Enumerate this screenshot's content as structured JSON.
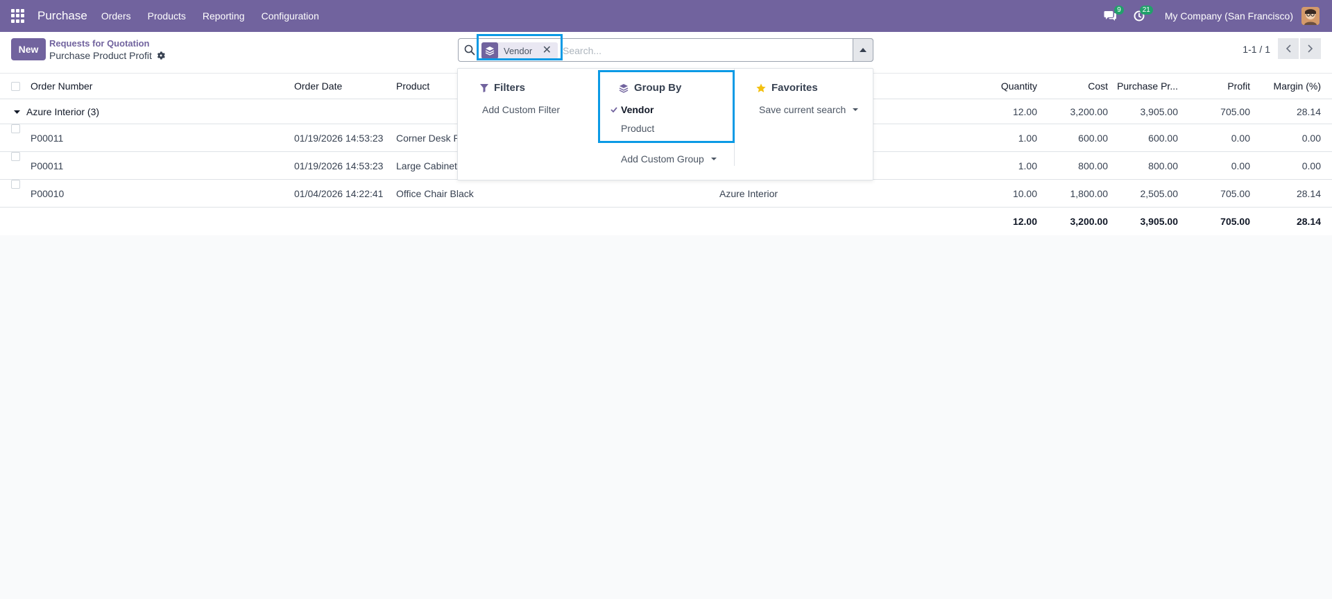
{
  "navbar": {
    "app_name": "Purchase",
    "menu": [
      "Orders",
      "Products",
      "Reporting",
      "Configuration"
    ],
    "messages_count": "9",
    "activities_count": "21",
    "company": "My Company (San Francisco)",
    "color": "#71639e"
  },
  "control": {
    "new_label": "New",
    "breadcrumb_parent": "Requests for Quotation",
    "breadcrumb_current": "Purchase Product Profit",
    "search": {
      "facet_label": "Vendor",
      "placeholder": "Search..."
    },
    "pager": "1-1 / 1"
  },
  "dropdown": {
    "filters": {
      "title": "Filters",
      "items": [
        "Add Custom Filter"
      ]
    },
    "group_by": {
      "title": "Group By",
      "items": [
        {
          "label": "Vendor",
          "checked": true
        },
        {
          "label": "Product",
          "checked": false
        }
      ],
      "add_custom": "Add Custom Group"
    },
    "favorites": {
      "title": "Favorites",
      "items": [
        "Save current search"
      ]
    }
  },
  "table": {
    "columns": [
      "Order Number",
      "Order Date",
      "Product",
      "Quantity",
      "Cost",
      "Purchase Pr...",
      "Profit",
      "Margin (%)"
    ],
    "group": {
      "label": "Azure Interior (3)",
      "quantity": "12.00",
      "cost": "3,200.00",
      "purchase_price": "3,905.00",
      "profit": "705.00",
      "margin": "28.14"
    },
    "rows": [
      {
        "order": "P00011",
        "date": "01/19/2026 14:53:23",
        "product": "Corner Desk R",
        "vendor": "",
        "quantity": "1.00",
        "cost": "600.00",
        "purchase_price": "600.00",
        "profit": "0.00",
        "margin": "0.00"
      },
      {
        "order": "P00011",
        "date": "01/19/2026 14:53:23",
        "product": "Large Cabinet",
        "vendor": "",
        "quantity": "1.00",
        "cost": "800.00",
        "purchase_price": "800.00",
        "profit": "0.00",
        "margin": "0.00"
      },
      {
        "order": "P00010",
        "date": "01/04/2026 14:22:41",
        "product": "Office Chair Black",
        "vendor": "Azure Interior",
        "quantity": "10.00",
        "cost": "1,800.00",
        "purchase_price": "2,505.00",
        "profit": "705.00",
        "margin": "28.14"
      }
    ],
    "totals": {
      "quantity": "12.00",
      "cost": "3,200.00",
      "purchase_price": "3,905.00",
      "profit": "705.00",
      "margin": "28.14"
    }
  }
}
